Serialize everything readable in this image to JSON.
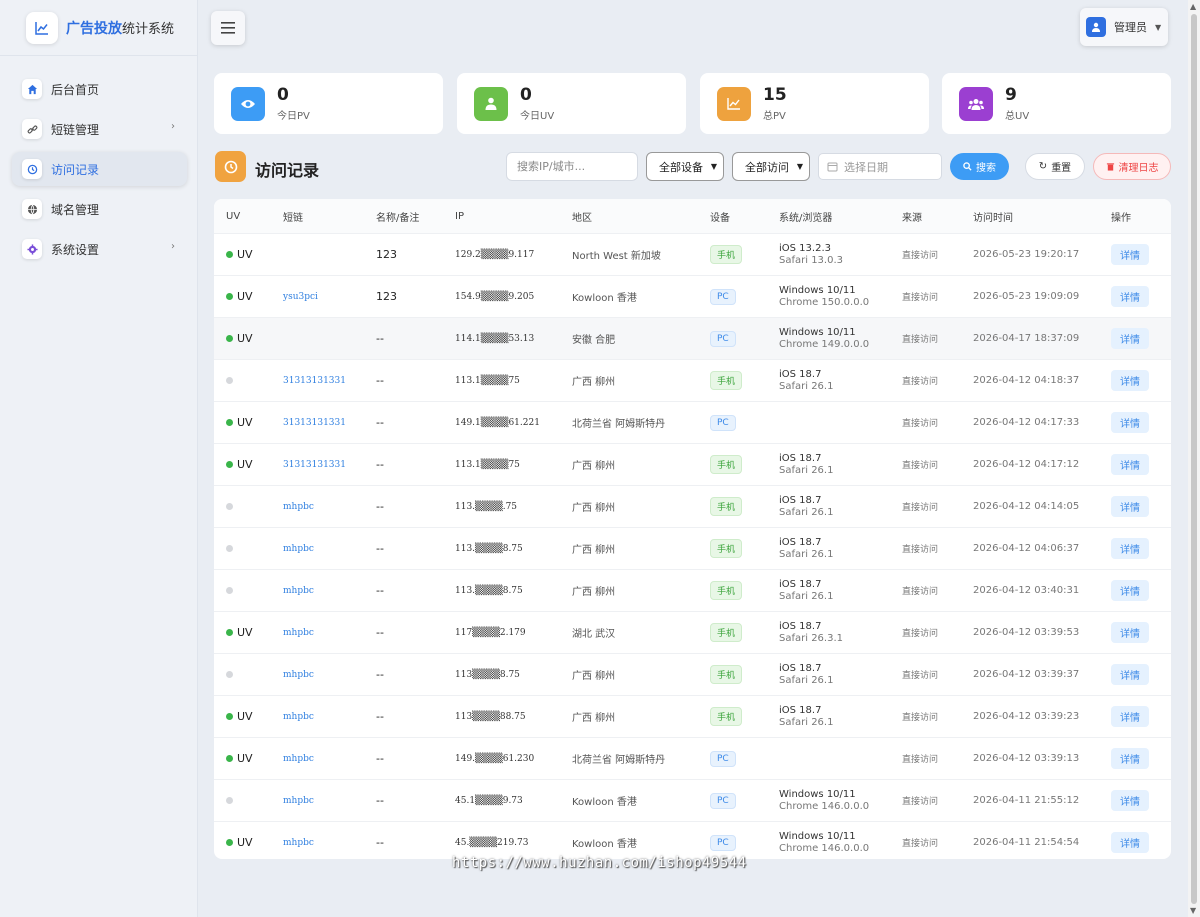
{
  "brand": {
    "title_main": "广告投放",
    "title_sub": "统计系统"
  },
  "sidebar": {
    "items": [
      {
        "label": "后台首页",
        "icon": "home-icon",
        "active": false,
        "arrow": ""
      },
      {
        "label": "短链管理",
        "icon": "link-icon",
        "active": false,
        "arrow": "›"
      },
      {
        "label": "访问记录",
        "icon": "history-icon",
        "active": true,
        "arrow": ""
      },
      {
        "label": "域名管理",
        "icon": "globe-icon",
        "active": false,
        "arrow": ""
      },
      {
        "label": "系统设置",
        "icon": "gear-icon",
        "active": false,
        "arrow": "›"
      }
    ]
  },
  "topbar": {
    "admin_label": "管理员"
  },
  "stats": [
    {
      "value": "0",
      "label": "今日PV",
      "color": "#3d9cf5"
    },
    {
      "value": "0",
      "label": "今日UV",
      "color": "#6cc04a"
    },
    {
      "value": "15",
      "label": "总PV",
      "color": "#eea23e"
    },
    {
      "value": "9",
      "label": "总UV",
      "color": "#9b3fd1"
    }
  ],
  "section": {
    "title": "访问记录"
  },
  "filters": {
    "search_placeholder": "搜索IP/城市...",
    "device_select": "全部设备",
    "visit_select": "全部访问",
    "date_placeholder": "选择日期",
    "search_btn": "搜索",
    "reset_btn": "重置",
    "clear_btn": "清理日志"
  },
  "table": {
    "headers": [
      "UV",
      "短链",
      "名称/备注",
      "IP",
      "地区",
      "设备",
      "系统/浏览器",
      "来源",
      "访问时间",
      "操作"
    ],
    "rows": [
      {
        "uv": "UV",
        "link": "",
        "name": "123",
        "ip": "129.2▒▒▒▒9.117",
        "region": "North West 新加坡",
        "device": "手机",
        "os": "iOS 13.2.3",
        "browser": "Safari 13.0.3",
        "source": "直接访问",
        "time": "2026-05-23 19:20:17",
        "op": "详情"
      },
      {
        "uv": "UV",
        "link": "ysu3pci",
        "name": "123",
        "ip": "154.9▒▒▒▒9.205",
        "region": "Kowloon 香港",
        "device": "PC",
        "os": "Windows 10/11",
        "browser": "Chrome 150.0.0.0",
        "source": "直接访问",
        "time": "2026-05-23 19:09:09",
        "op": "详情"
      },
      {
        "uv": "UV",
        "link": "",
        "name": "--",
        "ip": "114.1▒▒▒▒53.13",
        "region": "安徽 合肥",
        "device": "PC",
        "os": "Windows 10/11",
        "browser": "Chrome 149.0.0.0",
        "source": "直接访问",
        "time": "2026-04-17 18:37:09",
        "op": "详情"
      },
      {
        "uv": "",
        "link": "31313131331",
        "name": "--",
        "ip": "113.1▒▒▒▒75",
        "region": "广西 柳州",
        "device": "手机",
        "os": "iOS 18.7",
        "browser": "Safari 26.1",
        "source": "直接访问",
        "time": "2026-04-12 04:18:37",
        "op": "详情"
      },
      {
        "uv": "UV",
        "link": "31313131331",
        "name": "--",
        "ip": "149.1▒▒▒▒61.221",
        "region": "北荷兰省 阿姆斯特丹",
        "device": "PC",
        "os": "",
        "browser": "",
        "source": "直接访问",
        "time": "2026-04-12 04:17:33",
        "op": "详情"
      },
      {
        "uv": "UV",
        "link": "31313131331",
        "name": "--",
        "ip": "113.1▒▒▒▒75",
        "region": "广西 柳州",
        "device": "手机",
        "os": "iOS 18.7",
        "browser": "Safari 26.1",
        "source": "直接访问",
        "time": "2026-04-12 04:17:12",
        "op": "详情"
      },
      {
        "uv": "",
        "link": "mhpbc",
        "name": "--",
        "ip": "113.▒▒▒▒.75",
        "region": "广西 柳州",
        "device": "手机",
        "os": "iOS 18.7",
        "browser": "Safari 26.1",
        "source": "直接访问",
        "time": "2026-04-12 04:14:05",
        "op": "详情"
      },
      {
        "uv": "",
        "link": "mhpbc",
        "name": "--",
        "ip": "113.▒▒▒▒8.75",
        "region": "广西 柳州",
        "device": "手机",
        "os": "iOS 18.7",
        "browser": "Safari 26.1",
        "source": "直接访问",
        "time": "2026-04-12 04:06:37",
        "op": "详情"
      },
      {
        "uv": "",
        "link": "mhpbc",
        "name": "--",
        "ip": "113.▒▒▒▒8.75",
        "region": "广西 柳州",
        "device": "手机",
        "os": "iOS 18.7",
        "browser": "Safari 26.1",
        "source": "直接访问",
        "time": "2026-04-12 03:40:31",
        "op": "详情"
      },
      {
        "uv": "UV",
        "link": "mhpbc",
        "name": "--",
        "ip": "117▒▒▒▒2.179",
        "region": "湖北 武汉",
        "device": "手机",
        "os": "iOS 18.7",
        "browser": "Safari 26.3.1",
        "source": "直接访问",
        "time": "2026-04-12 03:39:53",
        "op": "详情"
      },
      {
        "uv": "",
        "link": "mhpbc",
        "name": "--",
        "ip": "113▒▒▒▒8.75",
        "region": "广西 柳州",
        "device": "手机",
        "os": "iOS 18.7",
        "browser": "Safari 26.1",
        "source": "直接访问",
        "time": "2026-04-12 03:39:37",
        "op": "详情"
      },
      {
        "uv": "UV",
        "link": "mhpbc",
        "name": "--",
        "ip": "113▒▒▒▒88.75",
        "region": "广西 柳州",
        "device": "手机",
        "os": "iOS 18.7",
        "browser": "Safari 26.1",
        "source": "直接访问",
        "time": "2026-04-12 03:39:23",
        "op": "详情"
      },
      {
        "uv": "UV",
        "link": "mhpbc",
        "name": "--",
        "ip": "149.▒▒▒▒61.230",
        "region": "北荷兰省 阿姆斯特丹",
        "device": "PC",
        "os": "",
        "browser": "",
        "source": "直接访问",
        "time": "2026-04-12 03:39:13",
        "op": "详情"
      },
      {
        "uv": "",
        "link": "mhpbc",
        "name": "--",
        "ip": "45.1▒▒▒▒9.73",
        "region": "Kowloon 香港",
        "device": "PC",
        "os": "Windows 10/11",
        "browser": "Chrome 146.0.0.0",
        "source": "直接访问",
        "time": "2026-04-11 21:55:12",
        "op": "详情"
      },
      {
        "uv": "UV",
        "link": "mhpbc",
        "name": "--",
        "ip": "45.▒▒▒▒219.73",
        "region": "Kowloon 香港",
        "device": "PC",
        "os": "Windows 10/11",
        "browser": "Chrome 146.0.0.0",
        "source": "直接访问",
        "time": "2026-04-11 21:54:54",
        "op": "详情"
      }
    ]
  },
  "watermark": "https://www.huzhan.com/ishop49544"
}
